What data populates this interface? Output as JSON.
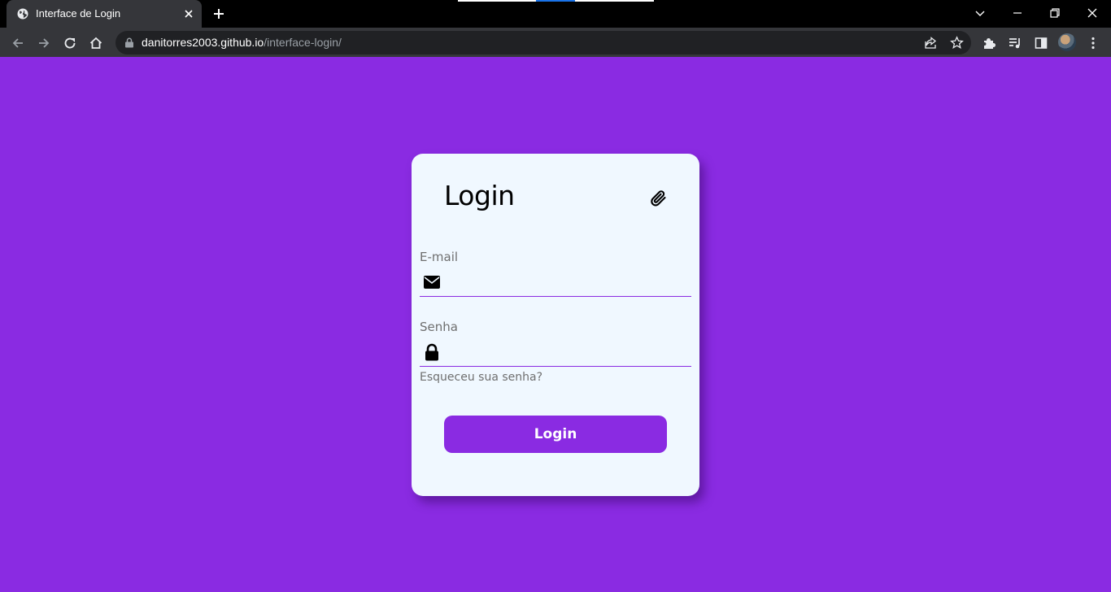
{
  "browser": {
    "tab_title": "Interface de Login",
    "url_host": "danitorres2003.github.io",
    "url_path": "/interface-login/"
  },
  "page": {
    "background_color": "#8a2be2",
    "card_color": "#f0f8ff",
    "title": "Login",
    "email_label": "E-mail",
    "email_value": "",
    "password_label": "Senha",
    "password_value": "",
    "forgot_link": "Esqueceu sua senha?",
    "login_button": "Login",
    "icons": [
      "paperclip-icon",
      "envelope-icon",
      "lock-icon"
    ]
  }
}
